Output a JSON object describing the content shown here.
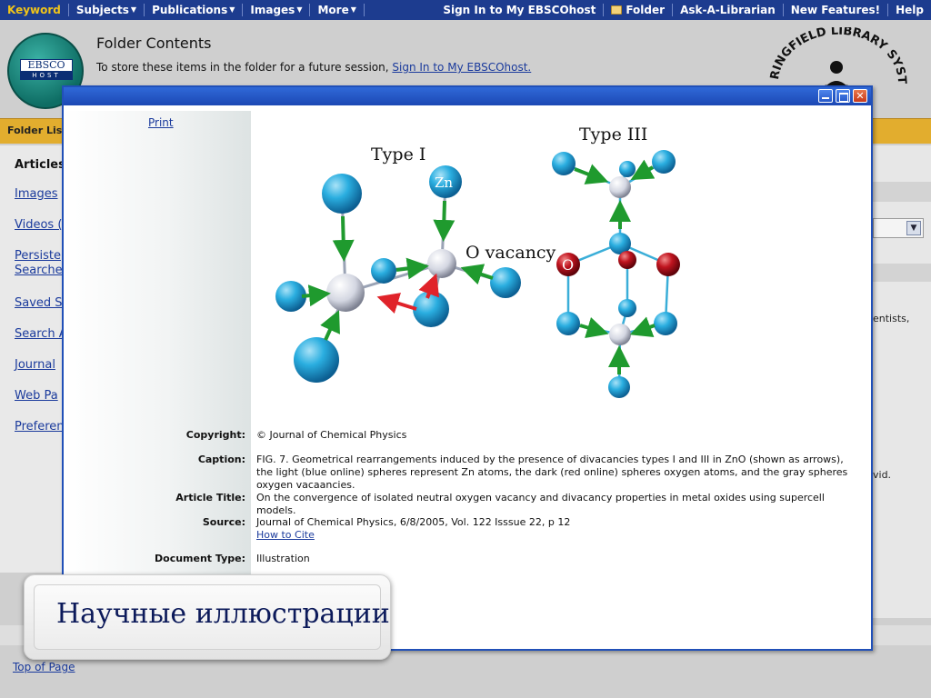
{
  "topnav": {
    "keyword": "Keyword",
    "subjects": "Subjects",
    "publications": "Publications",
    "images": "Images",
    "more": "More",
    "sign_in": "Sign In to My EBSCOhost",
    "folder": "Folder",
    "ask": "Ask-A-Librarian",
    "new_features": "New Features!",
    "help": "Help"
  },
  "header": {
    "logo_top": "EBSCO",
    "logo_bottom": "HOST",
    "title": "Folder Contents",
    "subtitle_prefix": "To store these items in the folder for a future session,",
    "subtitle_link": "Sign In to My EBSCOhost.",
    "library_logo_text": "RINGFIELD LIBRARY SYSTEM"
  },
  "folder_list_bar": "Folder Lis",
  "left_menu": {
    "header": "Articles",
    "items": [
      "Images",
      "Videos (",
      "Persiste",
      "Searche",
      "Saved S",
      "Search A",
      "Journal",
      "Web Pa",
      "Preferen"
    ]
  },
  "right_column": {
    "text1": "entists,",
    "text2": "vid."
  },
  "modal": {
    "print": "Print",
    "figure": {
      "type1": "Type I",
      "type3": "Type III",
      "zn": "Zn",
      "o_vacancy": "O vacancy",
      "o_label": "O"
    },
    "fields": {
      "copyright_label": "Copyright:",
      "copyright_value": "© Journal of Chemical Physics",
      "caption_label": "Caption:",
      "caption_value": "FIG. 7. Geometrical rearrangements induced by the presence of divacancies  types I and III in ZnO (shown as arrows), the light (blue online) spheres represent Zn atoms, the dark (red online) spheres oxygen atoms, and the gray spheres oxygen vacaancies.",
      "title_label": "Article Title:",
      "title_value": "On the convergence of isolated neutral oxygen vacancy and divacancy properties in metal oxides using supercell models.",
      "source_label": "Source:",
      "source_value": "Journal of Chemical Physics, 6/8/2005, Vol. 122 Isssue 22, p 12",
      "how_to_cite": "How to Cite",
      "doctype_label": "Document Type:",
      "doctype_value": "Illustration"
    }
  },
  "top_of_page": "Top of Page",
  "slide_caption": "Научные иллюстрации",
  "colors": {
    "nav_bg": "#1d3c8f",
    "nav_active": "#f0c419",
    "window_blue": "#2150b8",
    "zn_atom": "#1e9fd6",
    "o_atom": "#b0101c",
    "vacancy": "#d8dbe4",
    "arrow_green": "#1f9a2e",
    "arrow_red": "#e0232a",
    "orange_bar": "#e2ad2e"
  }
}
